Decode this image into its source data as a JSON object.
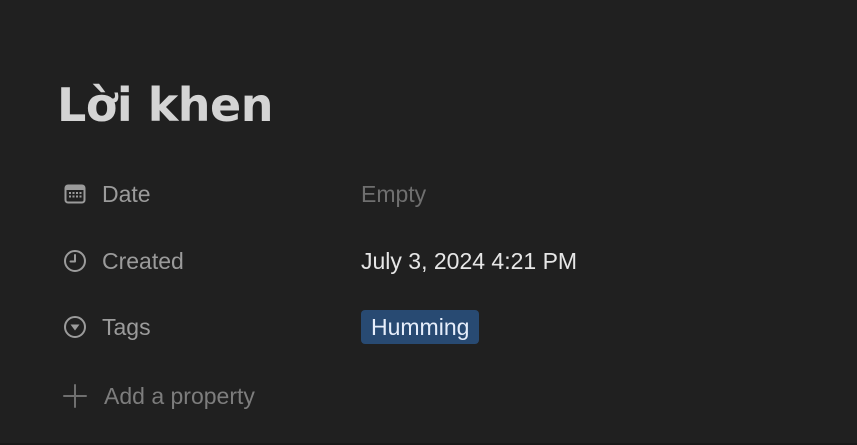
{
  "page": {
    "title": "Lời khen"
  },
  "properties": [
    {
      "name": "Date",
      "icon": "calendar-icon",
      "value": "Empty",
      "state": "empty"
    },
    {
      "name": "Created",
      "icon": "clock-icon",
      "value": "July 3, 2024 4:21 PM",
      "state": "filled"
    },
    {
      "name": "Tags",
      "icon": "select-circle-icon",
      "value": "Humming",
      "state": "tag",
      "tag_color": "#284a72"
    }
  ],
  "add_property": {
    "label": "Add a property",
    "icon": "plus-icon"
  },
  "colors": {
    "background": "#202020",
    "text_primary": "#d4d4d4",
    "text_muted": "#9b9b9b",
    "tag_background": "#284a72"
  }
}
